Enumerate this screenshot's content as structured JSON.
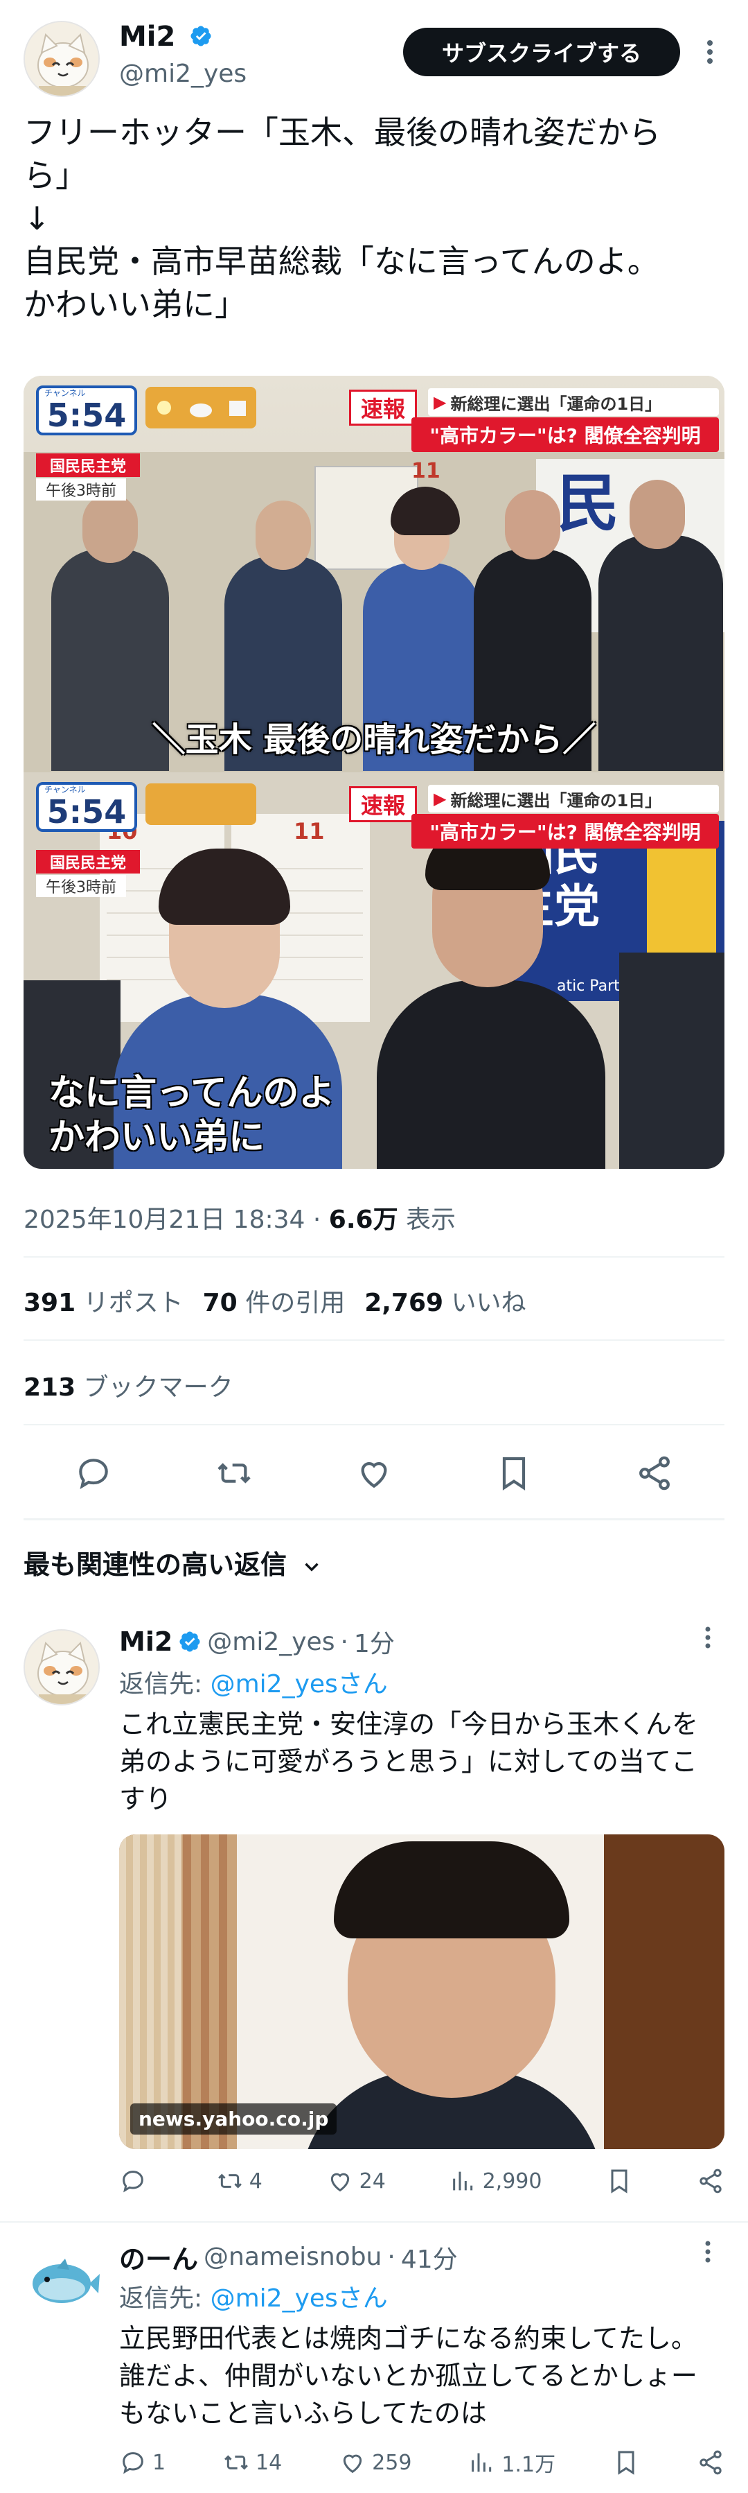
{
  "author": {
    "name": "Mi2",
    "handle": "@mi2_yes",
    "subscribe_label": "サブスクライブする"
  },
  "tweet": {
    "lines": [
      "フリーホッター「玉木、最後の晴れ姿だから",
      "ら」",
      "↓",
      "自民党・高市早苗総裁「なに言ってんのよ。",
      "かわいい弟に」"
    ],
    "timestamp": "2025年10月21日 18:34",
    "separator": "·",
    "views_count": "6.6万",
    "views_label": "表示",
    "reposts_count": "391",
    "reposts_label": "リポスト",
    "quotes_count": "70",
    "quotes_label": "件の引用",
    "likes_count": "2,769",
    "likes_label": "いいね",
    "bookmarks_count": "213",
    "bookmarks_label": "ブックマーク"
  },
  "media": {
    "top": {
      "clock": "5:54",
      "channel": "チャンネル",
      "breaking": "速報",
      "headline1": "新総理に選出「運命の1日」",
      "headline2": "\"高市カラー\"は? 閣僚全容判明",
      "party_tag": "国民民主党",
      "time_tag": "午後3時前",
      "calendar_month": "11",
      "subtitle": "＼玉木 最後の晴れ姿だから／"
    },
    "bottom": {
      "clock": "5:54",
      "channel": "チャンネル",
      "breaking": "速報",
      "headline1": "新総理に選出「運命の1日」",
      "headline2": "\"高市カラー\"は? 閣僚全容判明",
      "party_tag": "国民民主党",
      "time_tag": "午後3時前",
      "cal_month_left": "10",
      "cal_month_right": "11",
      "banner": "国民\n主党",
      "banner_english": "atic Party",
      "subtitle_line1": "なに言ってんのよ",
      "subtitle_line2": "かわいい弟に"
    }
  },
  "relevant_header": "最も関連性の高い返信",
  "replies": [
    {
      "name": "Mi2",
      "handle": "@mi2_yes",
      "separator": "·",
      "time": "1分",
      "reply_to_label": "返信先:",
      "reply_to_handle": "@mi2_yesさん",
      "text": "これ立憲民主党・安住淳の「今日から玉木くんを弟のように可愛がろうと思う」に対しての当てこすり",
      "image_source": "news.yahoo.co.jp",
      "stats": {
        "replies": "",
        "reposts": "4",
        "likes": "24",
        "views": "2,990"
      }
    },
    {
      "name": "のーん",
      "handle": "@nameisnobu",
      "separator": "·",
      "time": "41分",
      "reply_to_label": "返信先:",
      "reply_to_handle": "@mi2_yesさん",
      "text": "立民野田代表とは焼肉ゴチになる約束してたし。誰だよ、仲間がいないとか孤立してるとかしょーもないこと言いふらしてたのは",
      "stats": {
        "replies": "1",
        "reposts": "14",
        "likes": "259",
        "views": "1.1万"
      }
    }
  ],
  "colors": {
    "accent": "#1d9bf0",
    "text": "#0f1419",
    "muted": "#536471",
    "divider": "#eff3f4",
    "breaking_red": "#e0182d"
  }
}
